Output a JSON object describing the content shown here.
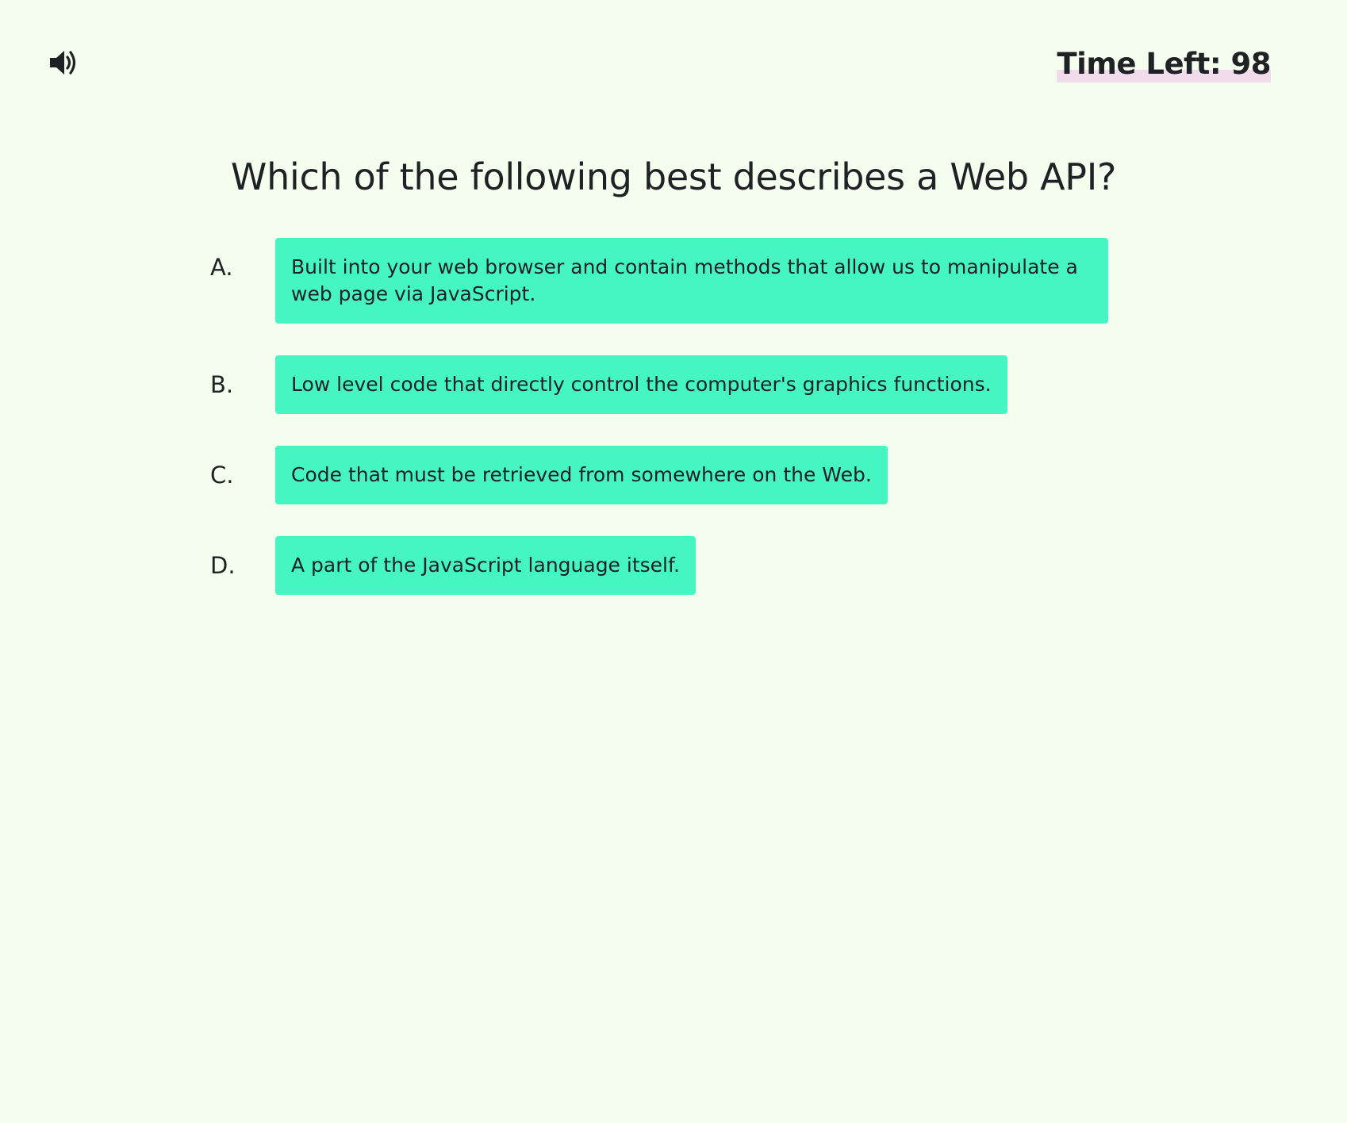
{
  "header": {
    "sound_icon": "speaker-volume-icon",
    "timer_label": "Time Left: 98"
  },
  "quiz": {
    "question": "Which of the following best describes a Web API?",
    "choices": [
      {
        "letter": "A.",
        "text": "Built into your web browser and contain methods that allow us to manipulate a web page via JavaScript."
      },
      {
        "letter": "B.",
        "text": "Low level code that directly control the computer's graphics functions."
      },
      {
        "letter": "C.",
        "text": "Code that must be retrieved from somewhere on the Web."
      },
      {
        "letter": "D.",
        "text": "A part of the JavaScript language itself."
      }
    ]
  },
  "colors": {
    "background": "#f5fdee",
    "choice_button": "#45f5c2",
    "timer_highlight": "#f1dcec",
    "text": "#1f2225"
  }
}
